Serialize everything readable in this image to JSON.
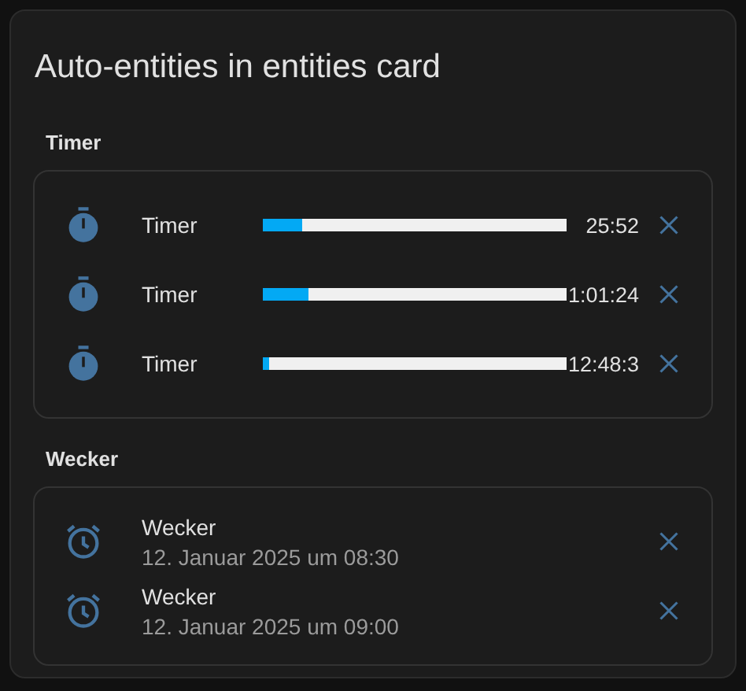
{
  "card": {
    "title": "Auto-entities in entities card"
  },
  "sections": [
    {
      "heading": "Timer",
      "kind": "timer",
      "rows": [
        {
          "name": "Timer",
          "level": 0.13,
          "time": "25:52"
        },
        {
          "name": "Timer",
          "level": 0.15,
          "time": "1:01:24"
        },
        {
          "name": "Timer",
          "level": 0.02,
          "time": "12:48:3"
        }
      ]
    },
    {
      "heading": "Wecker",
      "kind": "alarm",
      "rows": [
        {
          "name": "Wecker",
          "time": "12. Januar 2025 um 08:30"
        },
        {
          "name": "Wecker",
          "time": "12. Januar 2025 um 09:00"
        }
      ]
    }
  ]
}
